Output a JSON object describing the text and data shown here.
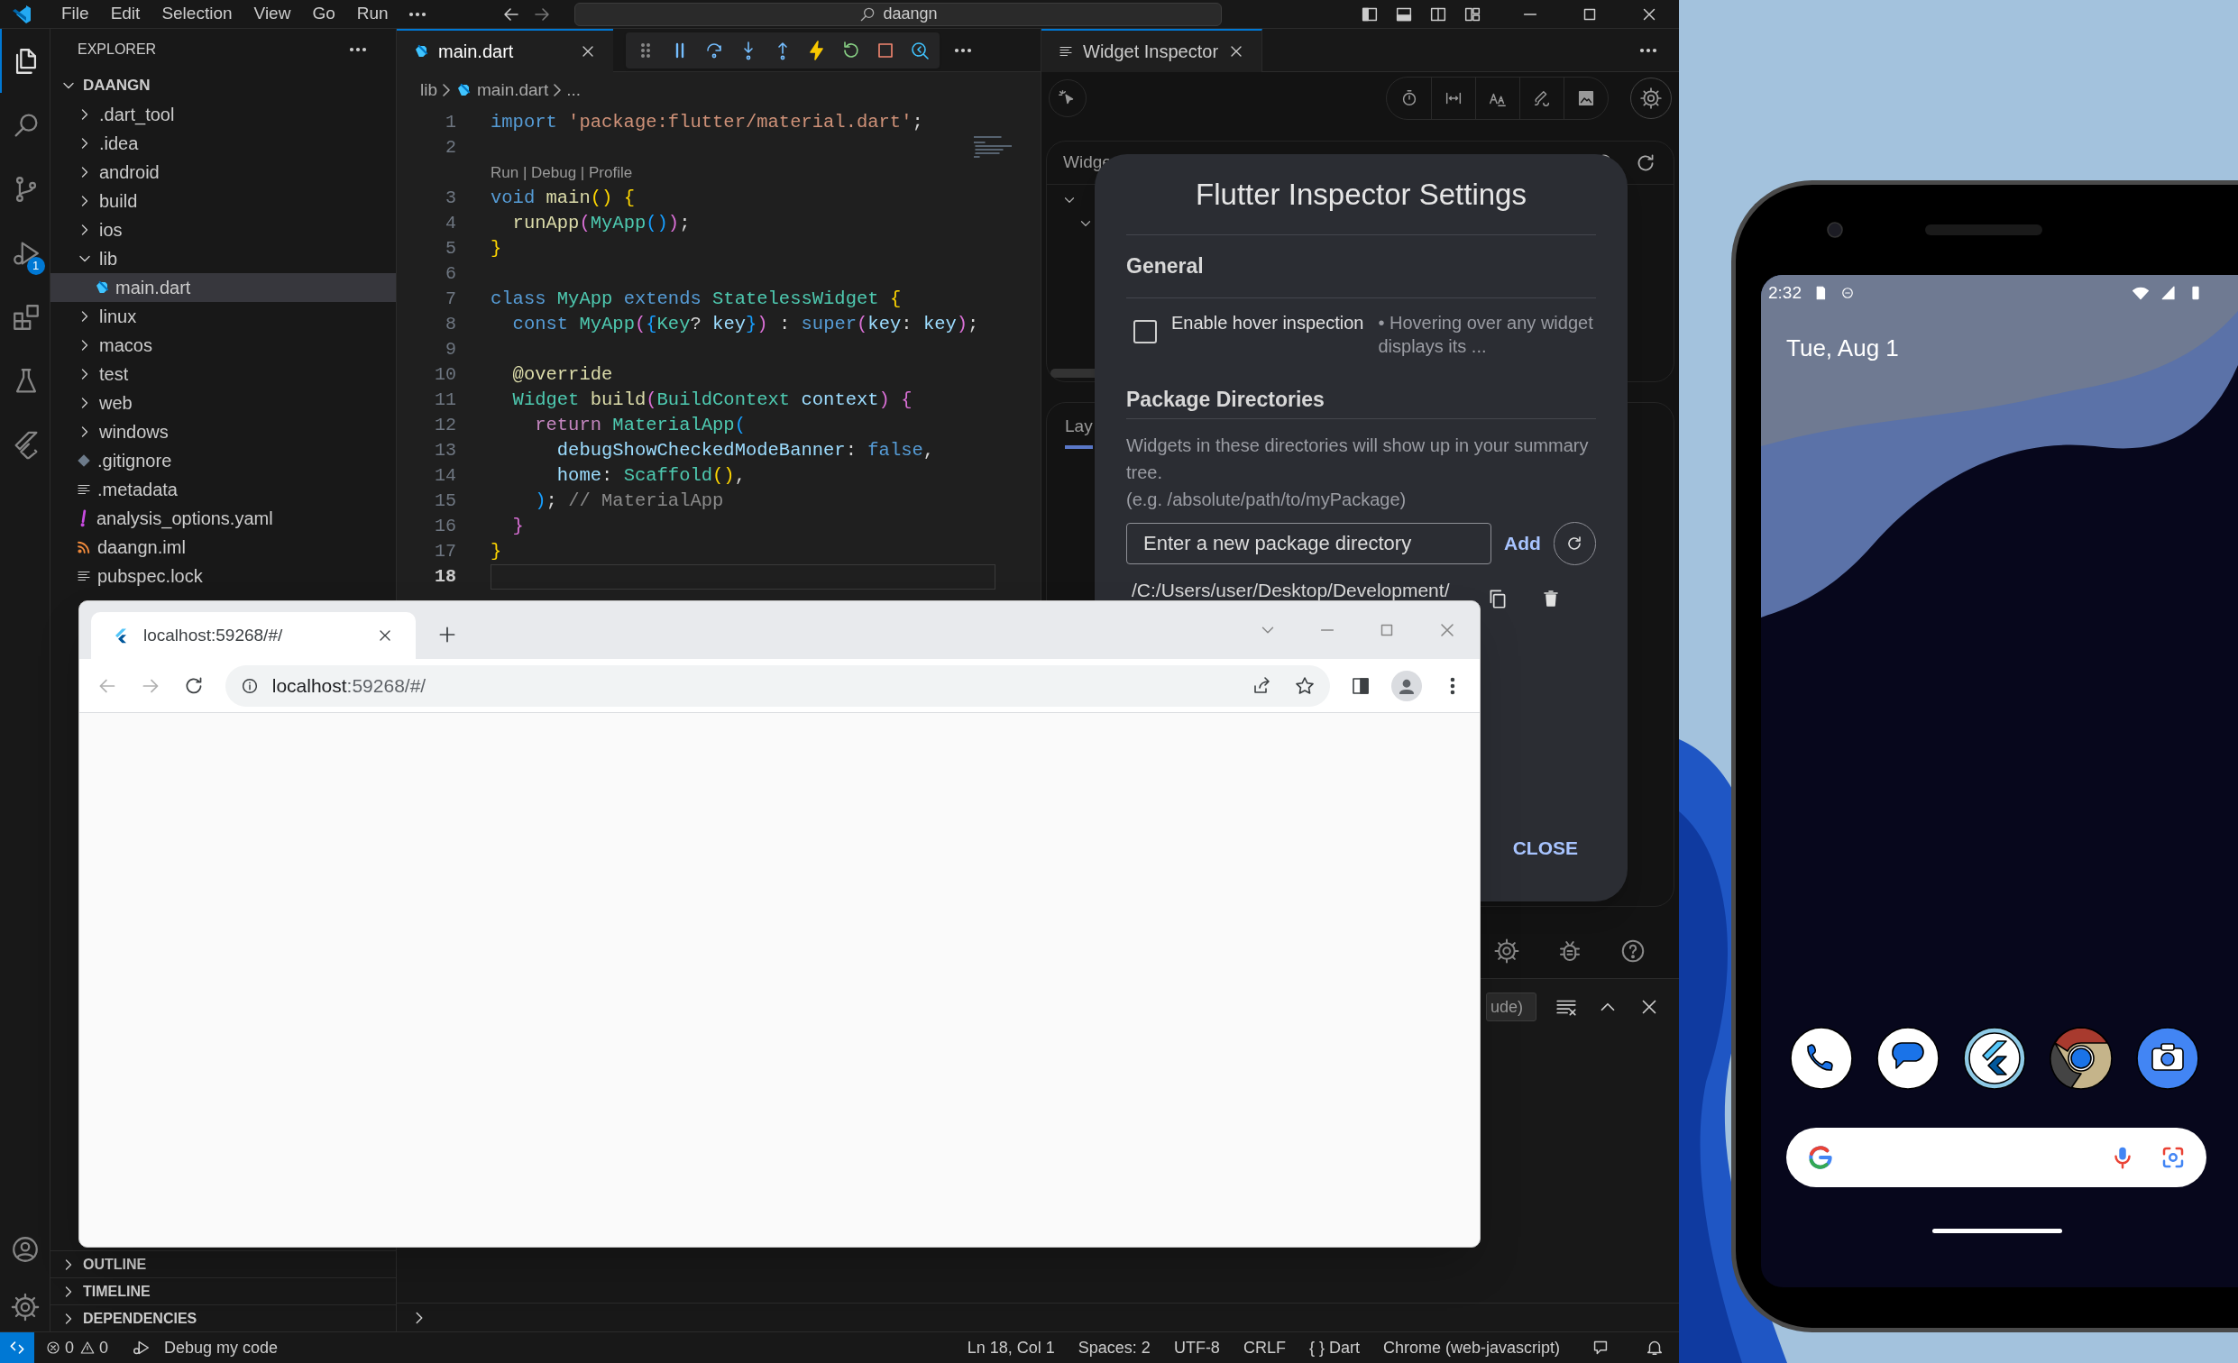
{
  "title_bar": {
    "menu": [
      "File",
      "Edit",
      "Selection",
      "View",
      "Go",
      "Run"
    ],
    "search": "daangn"
  },
  "activity_bar": [
    {
      "kind": "explorer",
      "selected": true
    },
    {
      "kind": "search",
      "selected": false
    },
    {
      "kind": "source-control",
      "selected": false
    },
    {
      "kind": "run-debug",
      "selected": false,
      "badge": "1"
    },
    {
      "kind": "extensions",
      "selected": false
    },
    {
      "kind": "testing",
      "selected": false
    },
    {
      "kind": "flutter",
      "selected": false
    }
  ],
  "explorer": {
    "title": "EXPLORER",
    "root": {
      "label": "DAANGN",
      "expanded": true
    },
    "items": [
      {
        "label": ".dart_tool",
        "kind": "folder",
        "expanded": false,
        "selected": false
      },
      {
        "label": ".idea",
        "kind": "folder",
        "expanded": false,
        "selected": false
      },
      {
        "label": "android",
        "kind": "folder",
        "expanded": false,
        "selected": false
      },
      {
        "label": "build",
        "kind": "folder",
        "expanded": false,
        "selected": false
      },
      {
        "label": "ios",
        "kind": "folder",
        "expanded": false,
        "selected": false
      },
      {
        "label": "lib",
        "kind": "folder",
        "expanded": true,
        "selected": false,
        "children": [
          {
            "label": "main.dart",
            "kind": "dart",
            "selected": true
          }
        ]
      },
      {
        "label": "linux",
        "kind": "folder",
        "expanded": false,
        "selected": false
      },
      {
        "label": "macos",
        "kind": "folder",
        "expanded": false,
        "selected": false
      },
      {
        "label": "test",
        "kind": "folder",
        "expanded": false,
        "selected": false
      },
      {
        "label": "web",
        "kind": "folder",
        "expanded": false,
        "selected": false
      },
      {
        "label": "windows",
        "kind": "folder",
        "expanded": false,
        "selected": false
      },
      {
        "label": ".gitignore",
        "kind": "git",
        "selected": false
      },
      {
        "label": ".metadata",
        "kind": "lines",
        "selected": false
      },
      {
        "label": "analysis_options.yaml",
        "kind": "yaml",
        "selected": false
      },
      {
        "label": "daangn.iml",
        "kind": "rss",
        "selected": false
      },
      {
        "label": "pubspec.lock",
        "kind": "lines",
        "selected": false
      }
    ],
    "sections": [
      {
        "label": "OUTLINE",
        "expanded": false
      },
      {
        "label": "TIMELINE",
        "expanded": false
      },
      {
        "label": "DEPENDENCIES",
        "expanded": false
      }
    ]
  },
  "editor": {
    "tab": {
      "label": "main.dart",
      "selected": true
    },
    "breadcrumb": [
      "lib",
      "main.dart",
      "..."
    ],
    "lines": [
      {
        "kind": "code",
        "number": "1",
        "current": false,
        "tokens": [
          {
            "kind": "kw",
            "text": "import"
          },
          {
            "kind": "str",
            "text": " 'package:flutter/material.dart'"
          },
          {
            "kind": "p",
            "text": ";"
          }
        ]
      },
      {
        "kind": "code",
        "number": "2",
        "current": false
      },
      {
        "kind": "lens",
        "text": "Run | Debug | Profile"
      },
      {
        "kind": "code",
        "number": "3",
        "current": false,
        "tokens": [
          {
            "kind": "kw",
            "text": "void"
          },
          {
            "kind": "fn",
            "text": " main"
          },
          {
            "kind": "b1",
            "text": "()"
          },
          {
            "kind": "b1",
            "text": " {"
          }
        ]
      },
      {
        "kind": "code",
        "number": "4",
        "current": false,
        "tokens": [
          {
            "kind": "fn",
            "text": "  runApp"
          },
          {
            "kind": "b2",
            "text": "("
          },
          {
            "kind": "type",
            "text": "MyApp"
          },
          {
            "kind": "b3",
            "text": "()"
          },
          {
            "kind": "b2",
            "text": ")"
          },
          {
            "kind": "p",
            "text": ";"
          }
        ]
      },
      {
        "kind": "code",
        "number": "5",
        "current": false,
        "tokens": [
          {
            "kind": "b1",
            "text": "}"
          }
        ]
      },
      {
        "kind": "code",
        "number": "6",
        "current": false
      },
      {
        "kind": "code",
        "number": "7",
        "current": false,
        "tokens": [
          {
            "kind": "kw",
            "text": "class"
          },
          {
            "kind": "type",
            "text": " MyApp"
          },
          {
            "kind": "kw",
            "text": " extends"
          },
          {
            "kind": "type",
            "text": " StatelessWidget"
          },
          {
            "kind": "b1",
            "text": " {"
          }
        ]
      },
      {
        "kind": "code",
        "number": "8",
        "current": false,
        "tokens": [
          {
            "kind": "kw",
            "text": "  const"
          },
          {
            "kind": "type",
            "text": " MyApp"
          },
          {
            "kind": "b2",
            "text": "("
          },
          {
            "kind": "b3",
            "text": "{"
          },
          {
            "kind": "type",
            "text": "Key"
          },
          {
            "kind": "p",
            "text": "?"
          },
          {
            "kind": "var",
            "text": " key"
          },
          {
            "kind": "b3",
            "text": "}"
          },
          {
            "kind": "b2",
            "text": ")"
          },
          {
            "kind": "p",
            "text": " :"
          },
          {
            "kind": "kw",
            "text": " super"
          },
          {
            "kind": "b2",
            "text": "("
          },
          {
            "kind": "var",
            "text": "key"
          },
          {
            "kind": "p",
            "text": ":"
          },
          {
            "kind": "var",
            "text": " key"
          },
          {
            "kind": "b2",
            "text": ")"
          },
          {
            "kind": "p",
            "text": ";"
          }
        ]
      },
      {
        "kind": "code",
        "number": "9",
        "current": false
      },
      {
        "kind": "code",
        "number": "10",
        "current": false,
        "tokens": [
          {
            "kind": "fn",
            "text": "  @override"
          }
        ]
      },
      {
        "kind": "code",
        "number": "11",
        "current": false,
        "tokens": [
          {
            "kind": "type",
            "text": "  Widget"
          },
          {
            "kind": "fn",
            "text": " build"
          },
          {
            "kind": "b2",
            "text": "("
          },
          {
            "kind": "type",
            "text": "BuildContext"
          },
          {
            "kind": "var",
            "text": " context"
          },
          {
            "kind": "b2",
            "text": ")"
          },
          {
            "kind": "b2",
            "text": " {"
          }
        ]
      },
      {
        "kind": "code",
        "number": "12",
        "current": false,
        "tokens": [
          {
            "kind": "ctrl",
            "text": "    return"
          },
          {
            "kind": "type",
            "text": " MaterialApp"
          },
          {
            "kind": "b3",
            "text": "("
          }
        ]
      },
      {
        "kind": "code",
        "number": "13",
        "current": false,
        "tokens": [
          {
            "kind": "var",
            "text": "      debugShowCheckedModeBanner"
          },
          {
            "kind": "p",
            "text": ":"
          },
          {
            "kind": "kw",
            "text": " false"
          },
          {
            "kind": "p",
            "text": ","
          }
        ]
      },
      {
        "kind": "code",
        "number": "14",
        "current": false,
        "tokens": [
          {
            "kind": "var",
            "text": "      home"
          },
          {
            "kind": "p",
            "text": ":"
          },
          {
            "kind": "type",
            "text": " Scaffold"
          },
          {
            "kind": "b1",
            "text": "()"
          },
          {
            "kind": "p",
            "text": ","
          }
        ]
      },
      {
        "kind": "code",
        "number": "15",
        "current": false,
        "tokens": [
          {
            "kind": "b3",
            "text": "    )"
          },
          {
            "kind": "p",
            "text": ";"
          },
          {
            "kind": "cmt",
            "text": " // MaterialApp"
          }
        ]
      },
      {
        "kind": "code",
        "number": "16",
        "current": false,
        "tokens": [
          {
            "kind": "b2",
            "text": "  }"
          }
        ]
      },
      {
        "kind": "code",
        "number": "17",
        "current": false,
        "tokens": [
          {
            "kind": "b1",
            "text": "}"
          }
        ]
      },
      {
        "kind": "code",
        "number": "18",
        "current": true
      }
    ]
  },
  "inspector": {
    "tab": {
      "label": "Widget Inspector",
      "selected": true
    },
    "tree_header": "Widge",
    "layout_tab": "Lay"
  },
  "settings_dialog": {
    "title": "Flutter Inspector Settings",
    "general": "General",
    "hover_inspection": {
      "label": "Enable hover inspection",
      "description": "• Hovering over any widget displays its ...",
      "checked": false
    },
    "packages": "Package Directories",
    "packages_description": [
      "Widgets in these directories will show up in your summary tree.",
      "(e.g. /absolute/path/to/myPackage)"
    ],
    "input": {
      "placeholder": "Enter a new package directory"
    },
    "add": "Add",
    "directory": "/C:/Users/user/Desktop/Development/",
    "close": "CLOSE"
  },
  "panel": {
    "filter": "ude)"
  },
  "status_bar": {
    "errors": "0",
    "warnings": "0",
    "debug": "Debug my code",
    "right": [
      "Ln 18, Col 1",
      "Spaces: 2",
      "UTF-8",
      "CRLF",
      "{ } Dart",
      "Chrome (web-javascript)"
    ]
  },
  "browser": {
    "tab": {
      "label": "localhost:59268/#/",
      "selected": true
    },
    "url": {
      "host": "localhost",
      "rest": ":59268/#/"
    }
  },
  "phone": {
    "time": "2:32",
    "date": "Tue, Aug 1",
    "dock": [
      {
        "kind": "phone"
      },
      {
        "kind": "messages"
      },
      {
        "kind": "flutter"
      },
      {
        "kind": "chrome"
      },
      {
        "kind": "camera"
      }
    ]
  }
}
